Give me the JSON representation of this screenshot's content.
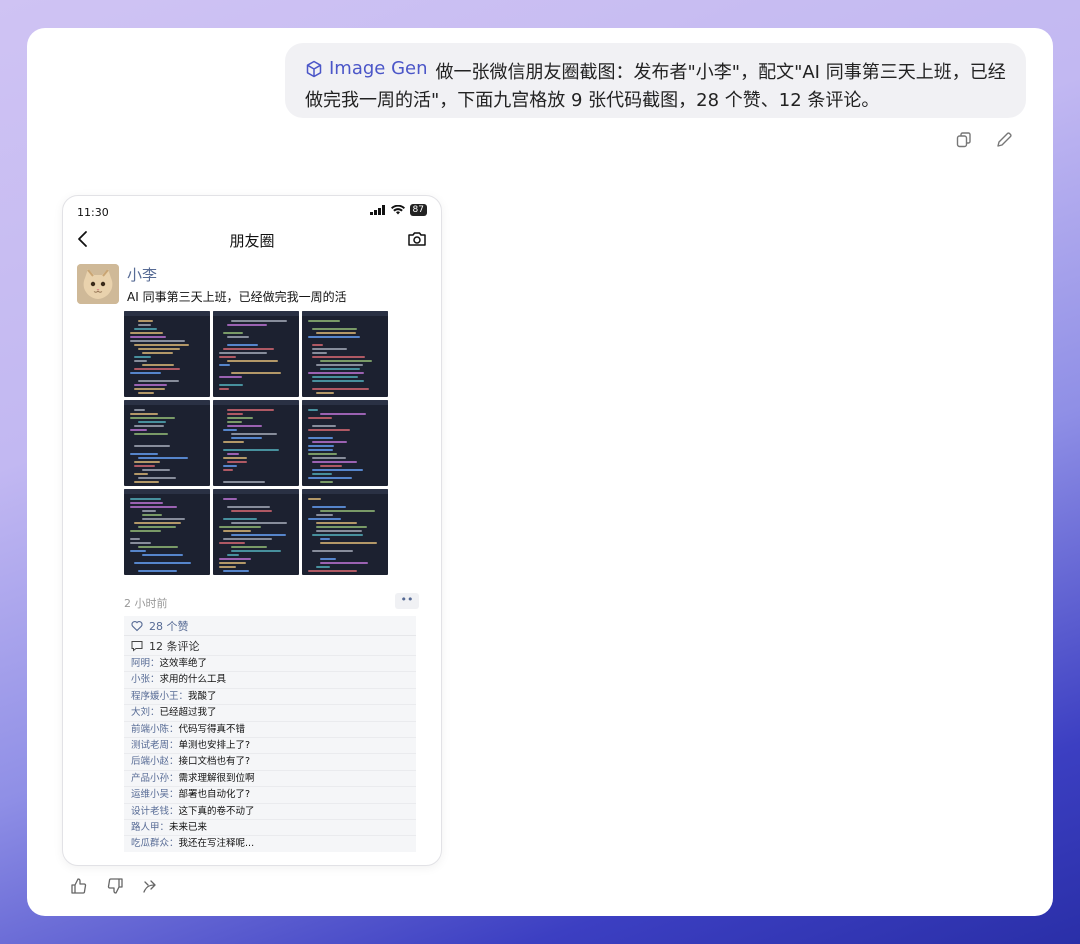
{
  "chat": {
    "tool_name": "Image Gen",
    "prompt": "做一张微信朋友圈截图：发布者\"小李\"，配文\"AI 同事第三天上班，已经做完我一周的活\"，下面九宫格放 9 张代码截图，28 个赞、12 条评论。"
  },
  "phone": {
    "time": "11:30",
    "battery": "87",
    "nav_title": "朋友圈"
  },
  "post": {
    "author": "小李",
    "text": "AI 同事第三天上班，已经做完我一周的活",
    "time_ago": "2 小时前",
    "more": "••",
    "likes": "28 个赞",
    "comment_count": "12 条评论",
    "comments": [
      {
        "name": "阿明",
        "text": "这效率绝了"
      },
      {
        "name": "小张",
        "text": "求用的什么工具"
      },
      {
        "name": "程序媛小王",
        "text": "我酸了"
      },
      {
        "name": "大刘",
        "text": "已经超过我了"
      },
      {
        "name": "前端小陈",
        "text": "代码写得真不错"
      },
      {
        "name": "测试老周",
        "text": "单测也安排上了?"
      },
      {
        "name": "后端小赵",
        "text": "接口文档也有了?"
      },
      {
        "name": "产品小孙",
        "text": "需求理解很到位啊"
      },
      {
        "name": "运维小吴",
        "text": "部署也自动化了?"
      },
      {
        "name": "设计老钱",
        "text": "这下真的卷不动了"
      },
      {
        "name": "路人甲",
        "text": "未来已来"
      },
      {
        "name": "吃瓜群众",
        "text": "我还在写注释呢..."
      }
    ]
  },
  "colors": {
    "link_blue": "#576b95",
    "tool_accent": "#4b56c8",
    "code_bg": "#1c2130"
  },
  "icons": [
    "cube-icon",
    "copy-icon",
    "edit-icon",
    "back-chevron-icon",
    "camera-icon",
    "heart-icon",
    "comment-icon",
    "thumbs-up-icon",
    "thumbs-down-icon",
    "share-icon"
  ]
}
